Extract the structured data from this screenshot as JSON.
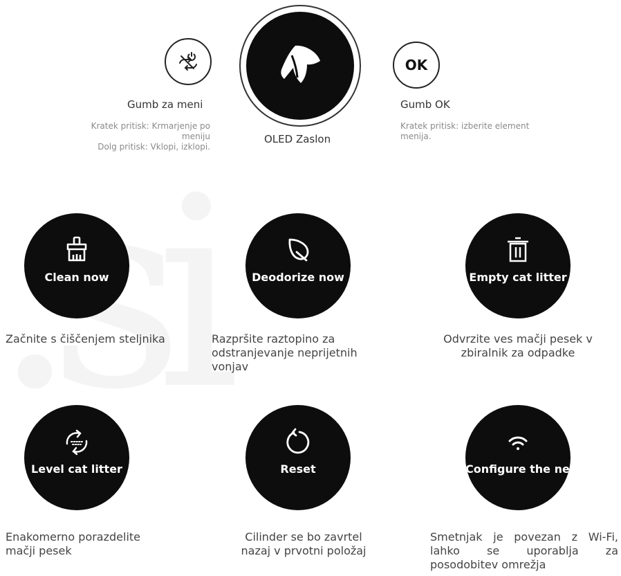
{
  "top": {
    "menu_button": {
      "label": "Gumb za meni",
      "note_line1": "Kratek pritisk: Krmarjenje po",
      "note_line2": "meniju",
      "note_line3": "Dolg pritisk: Vklopi, izklopi.",
      "icon": "power-cycle-icon"
    },
    "oled": {
      "label": "OLED Zaslon",
      "icon": "dog-logo-icon"
    },
    "ok_button": {
      "glyph": "OK",
      "label": "Gumb OK",
      "note_line1": "Kratek pritisk: izberite element",
      "note_line2": "menija."
    }
  },
  "functions": [
    {
      "caption": "Clean now",
      "icon": "broom-icon",
      "description": "Začnite s čiščenjem steljnika"
    },
    {
      "caption": "Deodorize now",
      "icon": "leaf-icon",
      "description": "Razpršite raztopino za odstranjevanje neprijetnih vonjav"
    },
    {
      "caption": "Empty cat litter",
      "icon": "trash-icon",
      "description": "Odvrzite ves mačji pesek v zbiralnik za odpadke"
    },
    {
      "caption": "Level cat litter",
      "icon": "level-cycle-icon",
      "description": "Enakomerno porazdelite mačji pesek"
    },
    {
      "caption": "Reset",
      "icon": "reset-icon",
      "description": "Cilinder se bo zavrtel nazaj v prvotni položaj"
    },
    {
      "caption": "Configure the network",
      "icon": "wifi-icon",
      "description": "Smetnjak je povezan z Wi-Fi, lahko se uporablja za posodobitev omrežja"
    }
  ],
  "watermark": ".si",
  "colors": {
    "circle": "#0d0d0d",
    "text": "#333333",
    "note": "#8a8a8a"
  }
}
